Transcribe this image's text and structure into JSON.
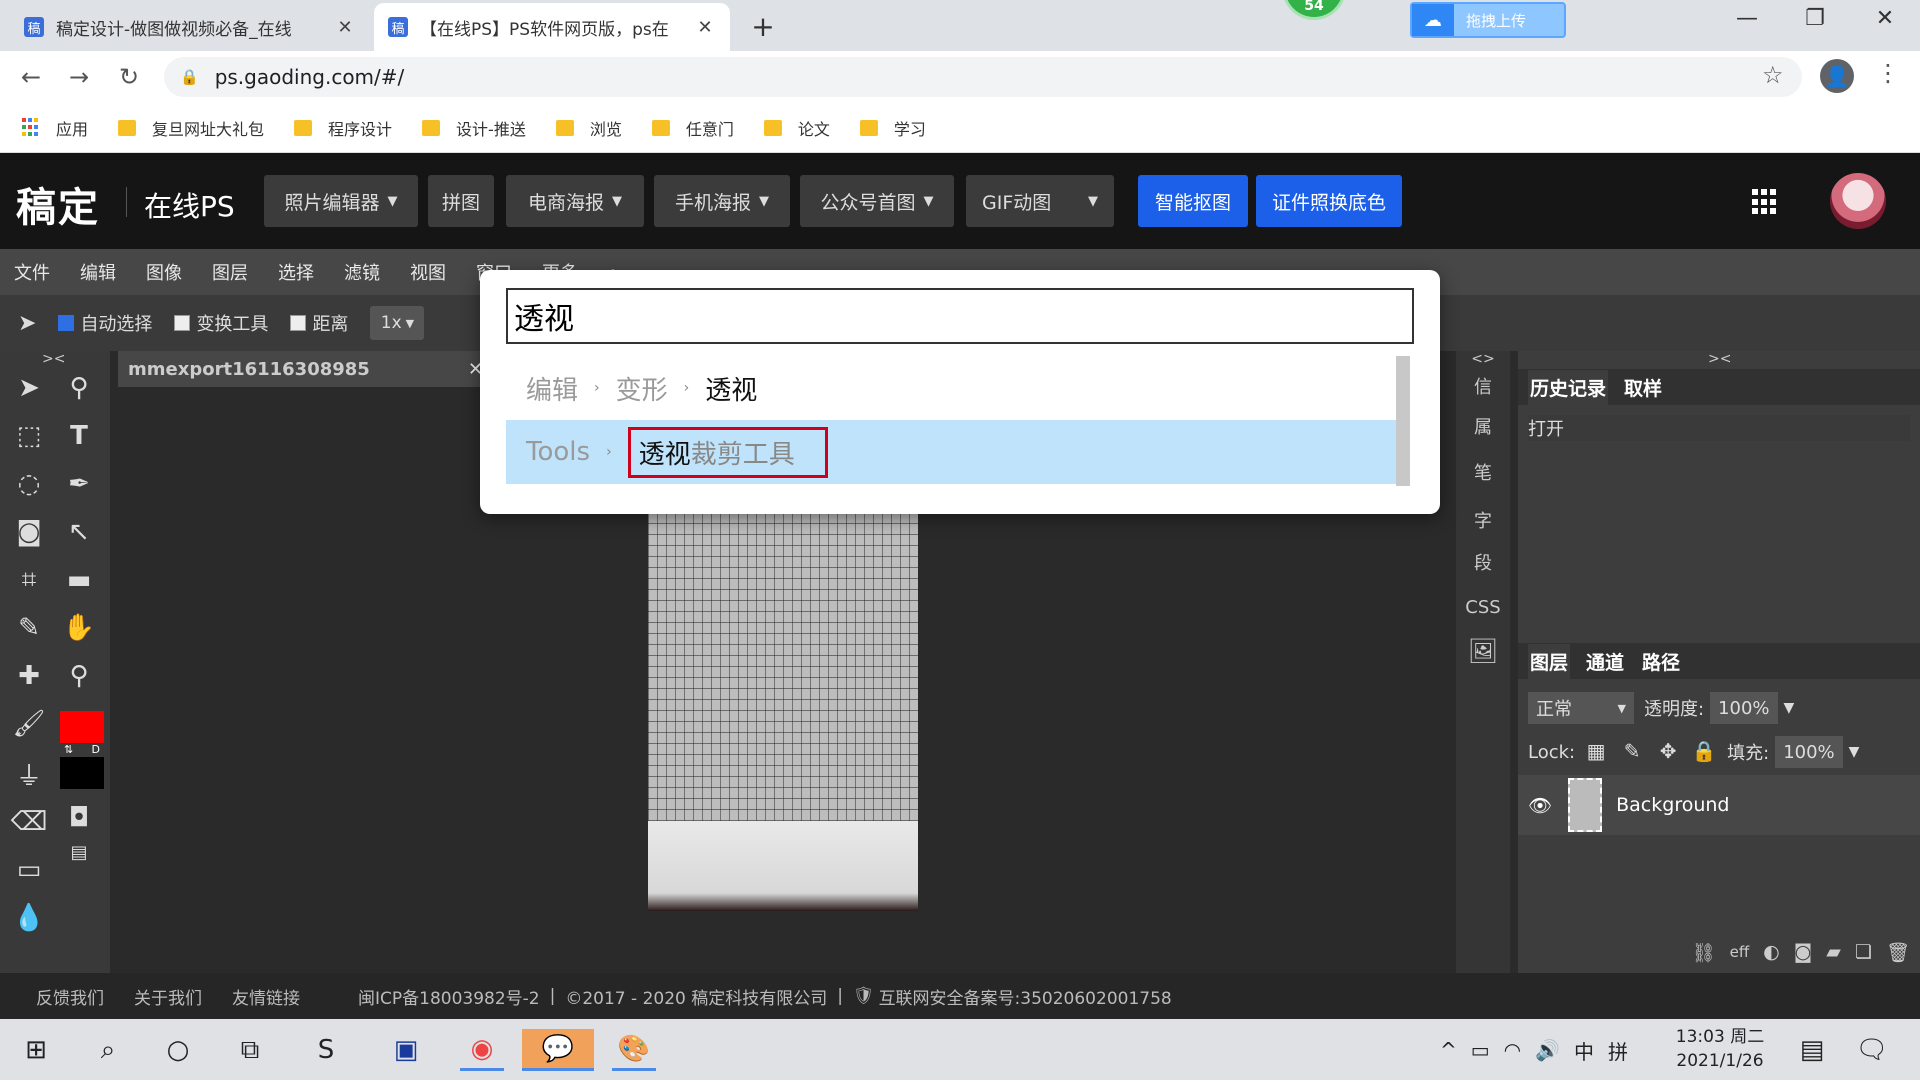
{
  "browser": {
    "tabs": [
      {
        "title": "稿定设计-做图做视频必备_在线",
        "favicon": "稿"
      },
      {
        "title": "【在线PS】PS软件网页版，ps在",
        "favicon": "稿"
      }
    ],
    "new_tab": "+",
    "badge_count": "54",
    "upload_label": "拖拽上传",
    "url": "ps.gaoding.com/#/",
    "bookmarks": [
      "应用",
      "复旦网址大礼包",
      "程序设计",
      "设计-推送",
      "浏览",
      "任意门",
      "论文",
      "学习"
    ]
  },
  "app": {
    "brand": "稿定",
    "brand_sub": "在线PS",
    "nav": [
      {
        "label": "照片编辑器",
        "dropdown": true
      },
      {
        "label": "拼图",
        "dropdown": false
      },
      {
        "label": "电商海报",
        "dropdown": true
      },
      {
        "label": "手机海报",
        "dropdown": true
      },
      {
        "label": "公众号首图",
        "dropdown": true
      },
      {
        "label": "GIF动图",
        "dropdown": true
      }
    ],
    "primary_buttons": [
      "智能抠图",
      "证件照换底色"
    ]
  },
  "menubar": [
    "文件",
    "编辑",
    "图像",
    "图层",
    "选择",
    "滤镜",
    "视图",
    "窗口",
    "更多"
  ],
  "options": {
    "auto_select": "自动选择",
    "transform_tool": "变换工具",
    "distance": "距离",
    "zoom": "1x"
  },
  "colors": {
    "foreground": "#ff0000",
    "background": "#000000",
    "accent": "#1c5fe9",
    "highlight": "#d0021b"
  },
  "document": {
    "tab_name": "mmexport16116308985"
  },
  "right_strip": [
    "信",
    "属",
    "笔",
    "字",
    "段",
    "CSS"
  ],
  "history": {
    "tabs": [
      "历史记录",
      "取样"
    ],
    "items": [
      "打开"
    ]
  },
  "layers": {
    "tabs": [
      "图层",
      "通道",
      "路径"
    ],
    "blend_mode": "正常",
    "opacity_label": "透明度:",
    "opacity_value": "100%",
    "lock_label": "Lock:",
    "fill_label": "填充:",
    "fill_value": "100%",
    "layer_name": "Background",
    "footer_fx": "eff"
  },
  "footer": {
    "links": [
      "反馈我们",
      "关于我们",
      "友情链接"
    ],
    "icp": "闽ICP备18003982号-2",
    "copyright": "©2017 - 2020 稿定科技有限公司",
    "security": "互联网安全备案号:35020602001758"
  },
  "search": {
    "query": "透视",
    "results": [
      {
        "path": [
          "编辑",
          "变形"
        ],
        "leaf": "透视"
      },
      {
        "path": [
          "Tools"
        ],
        "leaf_match": "透视",
        "leaf_rest": "裁剪工具"
      }
    ]
  },
  "taskbar": {
    "tray_ime": "中",
    "tray_layout": "拼",
    "time": "13:03 周二",
    "date": "2021/1/26"
  }
}
